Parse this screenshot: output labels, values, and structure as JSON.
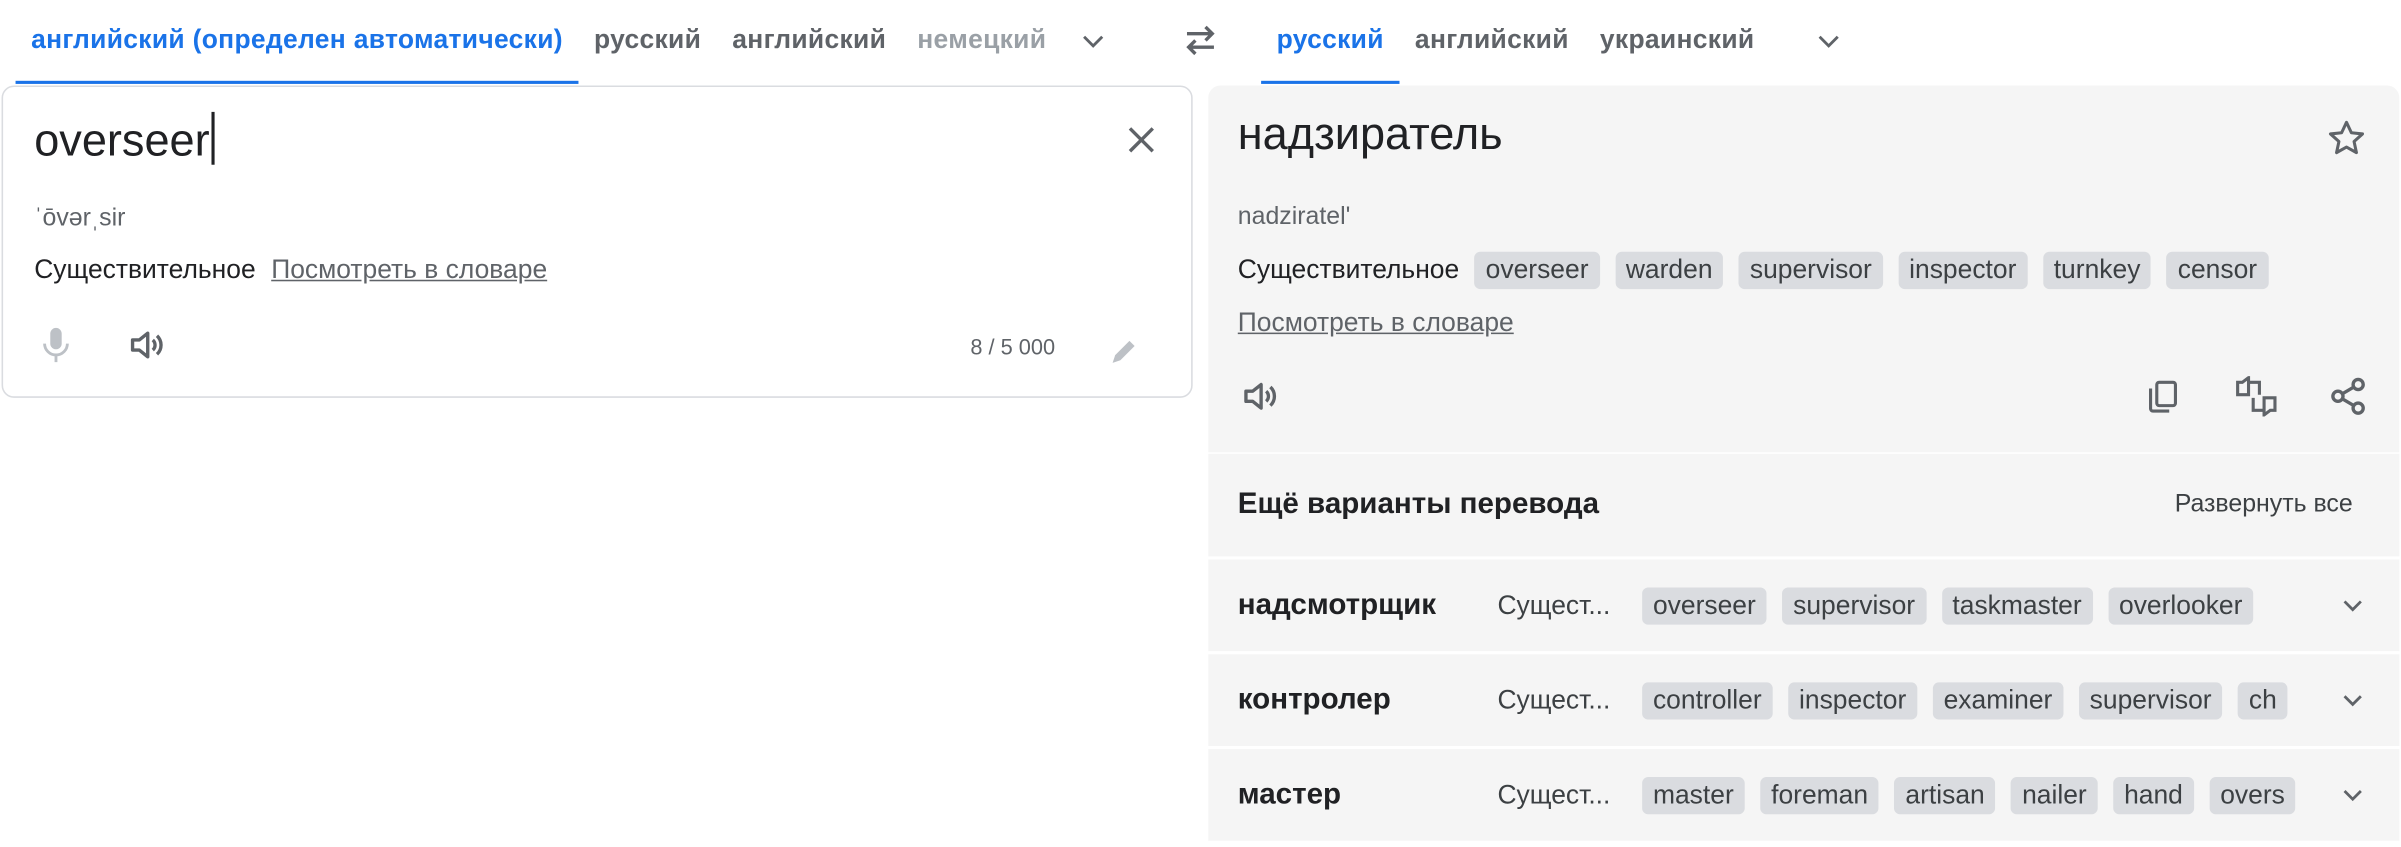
{
  "source_tabs": [
    "английский (определен автоматически)",
    "русский",
    "английский",
    "немецкий"
  ],
  "target_tabs": [
    "русский",
    "английский",
    "украинский"
  ],
  "source": {
    "text": "overseer",
    "transliteration": "ˈōvərˌsir",
    "pos": "Существительное",
    "dict_link": "Посмотреть в словаре",
    "counter": "8 / 5 000"
  },
  "target": {
    "text": "надзиратель",
    "transliteration": "nadziratel'",
    "pos": "Существительное",
    "synonyms": [
      "overseer",
      "warden",
      "supervisor",
      "inspector",
      "turnkey",
      "censor"
    ],
    "dict_link": "Посмотреть в словаре"
  },
  "more": {
    "title": "Ещё варианты перевода",
    "expand_all": "Развернуть все",
    "rows": [
      {
        "word": "надсмотрщик",
        "pos": "Сущест...",
        "chips": [
          "overseer",
          "supervisor",
          "taskmaster",
          "overlooker"
        ]
      },
      {
        "word": "контролер",
        "pos": "Сущест...",
        "chips": [
          "controller",
          "inspector",
          "examiner",
          "supervisor",
          "ch"
        ]
      },
      {
        "word": "мастер",
        "pos": "Сущест...",
        "chips": [
          "master",
          "foreman",
          "artisan",
          "nailer",
          "hand",
          "overs"
        ]
      }
    ]
  },
  "colors": {
    "accent": "#1a73e8",
    "panel": "#f5f5f5",
    "chip": "#dadce0"
  },
  "icons": [
    "chevron-down-icon",
    "swap-icon",
    "close-icon",
    "mic-icon",
    "speaker-icon",
    "pencil-icon",
    "star-icon",
    "copy-icon",
    "feedback-icon",
    "share-icon"
  ]
}
